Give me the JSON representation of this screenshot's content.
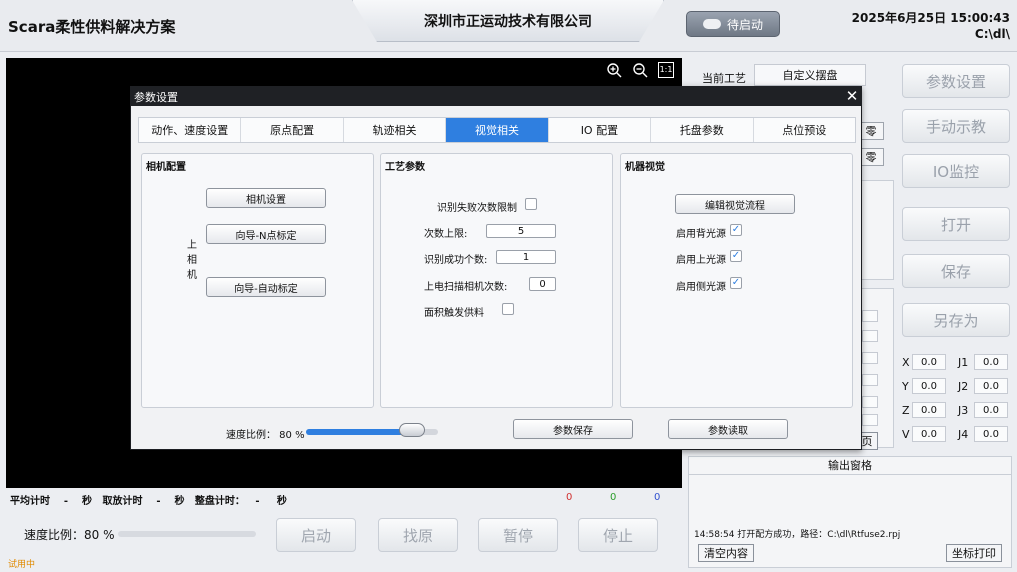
{
  "header": {
    "app_title": "Scara柔性供料解决方案",
    "company_name": "深圳市正运动技术有限公司",
    "state_button": "待启动",
    "date_time": "2025年6月25日   15:00:43",
    "path": "C:\\dl\\"
  },
  "view": {
    "zoom_in_icon": "zoom-in-icon",
    "zoom_out_icon": "zoom-out-icon",
    "actual_size_label": "1:1"
  },
  "right_panel": {
    "craft_label": "当前工艺",
    "craft_value": "自定义摆盘",
    "zero_buttons": [
      "零",
      "零"
    ],
    "buttons": [
      "参数设置",
      "手动示教",
      "IO监控",
      "打开",
      "保存",
      "另存为"
    ],
    "coords": [
      {
        "label": "X",
        "value": "0.0",
        "label2": "J1",
        "value2": "0.0"
      },
      {
        "label": "Y",
        "value": "0.0",
        "label2": "J2",
        "value2": "0.0"
      },
      {
        "label": "Z",
        "value": "0.0",
        "label2": "J3",
        "value2": "0.0"
      },
      {
        "label": "V",
        "value": "0.0",
        "label2": "J4",
        "value2": "0.0"
      }
    ],
    "partial_button": "页"
  },
  "output": {
    "title": "输出窗格",
    "log_line": "14:58:54  打开配方成功，路径：C:\\dl\\Rtfuse2.rpj",
    "clear_button": "清空内容",
    "print_button": "坐标打印"
  },
  "bottom": {
    "timer_text": "平均计时    -    秒   取放计时    -    秒   整盘计时：   -     秒",
    "counters": [
      "0",
      "0",
      "0"
    ],
    "counter_colors": [
      "#d03030",
      "#2a9d2a",
      "#3050d0"
    ],
    "speed_label": "速度比例：80 %",
    "speed_percent": 0,
    "buttons": [
      "启动",
      "找原",
      "暂停",
      "停止"
    ],
    "trial": "试用中"
  },
  "dialog": {
    "title": "参数设置",
    "close_icon": "close-icon",
    "tabs": [
      {
        "label": "动作、速度设置",
        "active": false
      },
      {
        "label": "原点配置",
        "active": false
      },
      {
        "label": "轨迹相关",
        "active": false
      },
      {
        "label": "视觉相关",
        "active": true
      },
      {
        "label": "IO 配置",
        "active": false
      },
      {
        "label": "托盘参数",
        "active": false
      },
      {
        "label": "点位预设",
        "active": false
      }
    ],
    "camera": {
      "title": "相机配置",
      "vertical_label": "上相机",
      "buttons": [
        "相机设置",
        "向导-N点标定",
        "向导-自动标定"
      ]
    },
    "process": {
      "title": "工艺参数",
      "fail_limit_label": "识别失败次数限制",
      "fail_limit_checked": false,
      "max_count_label": "次数上限:",
      "max_count_value": "5",
      "success_label": "识别成功个数:",
      "success_value": "1",
      "scan_label": "上电扫描相机次数:",
      "scan_value": "0",
      "area_trigger_label": "面积触发供料",
      "area_trigger_checked": false
    },
    "vision": {
      "title": "机器视觉",
      "edit_button": "编辑视觉流程",
      "back_light_label": "启用背光源",
      "top_light_label": "启用上光源",
      "side_light_label": "启用侧光源",
      "checked_mark": "✓"
    },
    "speed_label": "速度比例：  80 %",
    "speed_percent": 80,
    "save_button": "参数保存",
    "load_button": "参数读取"
  },
  "colors": {
    "accent": "#2f7fe0",
    "titlebar": "#1f2125"
  }
}
